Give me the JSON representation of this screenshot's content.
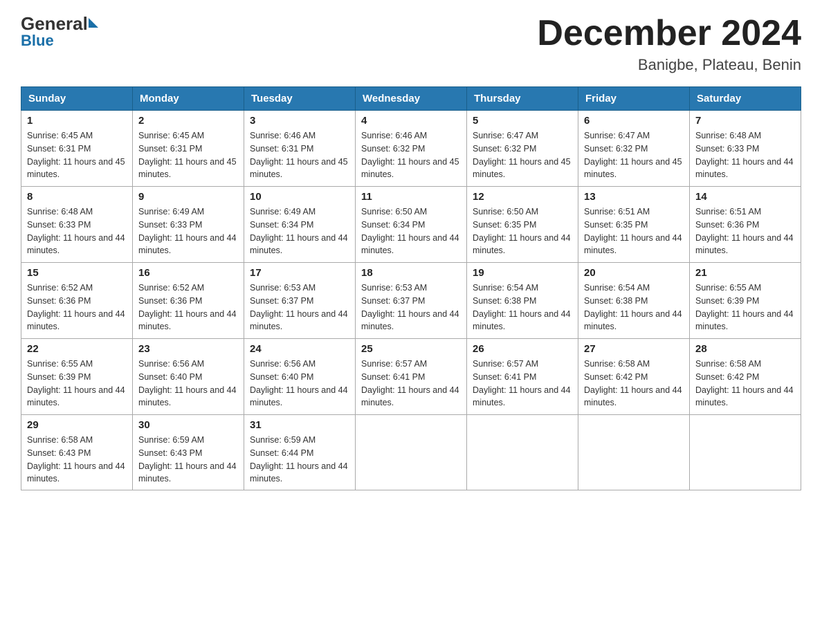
{
  "logo": {
    "general": "General",
    "blue": "Blue"
  },
  "title": {
    "month_year": "December 2024",
    "location": "Banigbe, Plateau, Benin"
  },
  "days_of_week": [
    "Sunday",
    "Monday",
    "Tuesday",
    "Wednesday",
    "Thursday",
    "Friday",
    "Saturday"
  ],
  "weeks": [
    [
      {
        "day": "1",
        "sunrise": "Sunrise: 6:45 AM",
        "sunset": "Sunset: 6:31 PM",
        "daylight": "Daylight: 11 hours and 45 minutes."
      },
      {
        "day": "2",
        "sunrise": "Sunrise: 6:45 AM",
        "sunset": "Sunset: 6:31 PM",
        "daylight": "Daylight: 11 hours and 45 minutes."
      },
      {
        "day": "3",
        "sunrise": "Sunrise: 6:46 AM",
        "sunset": "Sunset: 6:31 PM",
        "daylight": "Daylight: 11 hours and 45 minutes."
      },
      {
        "day": "4",
        "sunrise": "Sunrise: 6:46 AM",
        "sunset": "Sunset: 6:32 PM",
        "daylight": "Daylight: 11 hours and 45 minutes."
      },
      {
        "day": "5",
        "sunrise": "Sunrise: 6:47 AM",
        "sunset": "Sunset: 6:32 PM",
        "daylight": "Daylight: 11 hours and 45 minutes."
      },
      {
        "day": "6",
        "sunrise": "Sunrise: 6:47 AM",
        "sunset": "Sunset: 6:32 PM",
        "daylight": "Daylight: 11 hours and 45 minutes."
      },
      {
        "day": "7",
        "sunrise": "Sunrise: 6:48 AM",
        "sunset": "Sunset: 6:33 PM",
        "daylight": "Daylight: 11 hours and 44 minutes."
      }
    ],
    [
      {
        "day": "8",
        "sunrise": "Sunrise: 6:48 AM",
        "sunset": "Sunset: 6:33 PM",
        "daylight": "Daylight: 11 hours and 44 minutes."
      },
      {
        "day": "9",
        "sunrise": "Sunrise: 6:49 AM",
        "sunset": "Sunset: 6:33 PM",
        "daylight": "Daylight: 11 hours and 44 minutes."
      },
      {
        "day": "10",
        "sunrise": "Sunrise: 6:49 AM",
        "sunset": "Sunset: 6:34 PM",
        "daylight": "Daylight: 11 hours and 44 minutes."
      },
      {
        "day": "11",
        "sunrise": "Sunrise: 6:50 AM",
        "sunset": "Sunset: 6:34 PM",
        "daylight": "Daylight: 11 hours and 44 minutes."
      },
      {
        "day": "12",
        "sunrise": "Sunrise: 6:50 AM",
        "sunset": "Sunset: 6:35 PM",
        "daylight": "Daylight: 11 hours and 44 minutes."
      },
      {
        "day": "13",
        "sunrise": "Sunrise: 6:51 AM",
        "sunset": "Sunset: 6:35 PM",
        "daylight": "Daylight: 11 hours and 44 minutes."
      },
      {
        "day": "14",
        "sunrise": "Sunrise: 6:51 AM",
        "sunset": "Sunset: 6:36 PM",
        "daylight": "Daylight: 11 hours and 44 minutes."
      }
    ],
    [
      {
        "day": "15",
        "sunrise": "Sunrise: 6:52 AM",
        "sunset": "Sunset: 6:36 PM",
        "daylight": "Daylight: 11 hours and 44 minutes."
      },
      {
        "day": "16",
        "sunrise": "Sunrise: 6:52 AM",
        "sunset": "Sunset: 6:36 PM",
        "daylight": "Daylight: 11 hours and 44 minutes."
      },
      {
        "day": "17",
        "sunrise": "Sunrise: 6:53 AM",
        "sunset": "Sunset: 6:37 PM",
        "daylight": "Daylight: 11 hours and 44 minutes."
      },
      {
        "day": "18",
        "sunrise": "Sunrise: 6:53 AM",
        "sunset": "Sunset: 6:37 PM",
        "daylight": "Daylight: 11 hours and 44 minutes."
      },
      {
        "day": "19",
        "sunrise": "Sunrise: 6:54 AM",
        "sunset": "Sunset: 6:38 PM",
        "daylight": "Daylight: 11 hours and 44 minutes."
      },
      {
        "day": "20",
        "sunrise": "Sunrise: 6:54 AM",
        "sunset": "Sunset: 6:38 PM",
        "daylight": "Daylight: 11 hours and 44 minutes."
      },
      {
        "day": "21",
        "sunrise": "Sunrise: 6:55 AM",
        "sunset": "Sunset: 6:39 PM",
        "daylight": "Daylight: 11 hours and 44 minutes."
      }
    ],
    [
      {
        "day": "22",
        "sunrise": "Sunrise: 6:55 AM",
        "sunset": "Sunset: 6:39 PM",
        "daylight": "Daylight: 11 hours and 44 minutes."
      },
      {
        "day": "23",
        "sunrise": "Sunrise: 6:56 AM",
        "sunset": "Sunset: 6:40 PM",
        "daylight": "Daylight: 11 hours and 44 minutes."
      },
      {
        "day": "24",
        "sunrise": "Sunrise: 6:56 AM",
        "sunset": "Sunset: 6:40 PM",
        "daylight": "Daylight: 11 hours and 44 minutes."
      },
      {
        "day": "25",
        "sunrise": "Sunrise: 6:57 AM",
        "sunset": "Sunset: 6:41 PM",
        "daylight": "Daylight: 11 hours and 44 minutes."
      },
      {
        "day": "26",
        "sunrise": "Sunrise: 6:57 AM",
        "sunset": "Sunset: 6:41 PM",
        "daylight": "Daylight: 11 hours and 44 minutes."
      },
      {
        "day": "27",
        "sunrise": "Sunrise: 6:58 AM",
        "sunset": "Sunset: 6:42 PM",
        "daylight": "Daylight: 11 hours and 44 minutes."
      },
      {
        "day": "28",
        "sunrise": "Sunrise: 6:58 AM",
        "sunset": "Sunset: 6:42 PM",
        "daylight": "Daylight: 11 hours and 44 minutes."
      }
    ],
    [
      {
        "day": "29",
        "sunrise": "Sunrise: 6:58 AM",
        "sunset": "Sunset: 6:43 PM",
        "daylight": "Daylight: 11 hours and 44 minutes."
      },
      {
        "day": "30",
        "sunrise": "Sunrise: 6:59 AM",
        "sunset": "Sunset: 6:43 PM",
        "daylight": "Daylight: 11 hours and 44 minutes."
      },
      {
        "day": "31",
        "sunrise": "Sunrise: 6:59 AM",
        "sunset": "Sunset: 6:44 PM",
        "daylight": "Daylight: 11 hours and 44 minutes."
      },
      null,
      null,
      null,
      null
    ]
  ]
}
